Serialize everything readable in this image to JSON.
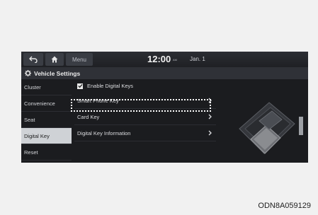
{
  "topbar": {
    "menu_label": "Menu",
    "time": "12:00",
    "ampm": "AM",
    "date": "Jan. 1"
  },
  "title": "Vehicle Settings",
  "sidebar": {
    "items": [
      {
        "label": "Cluster"
      },
      {
        "label": "Convenience"
      },
      {
        "label": "Seat"
      },
      {
        "label": "Digital Key",
        "active": true
      },
      {
        "label": "Reset"
      }
    ]
  },
  "content": {
    "enable_label": "Enable Digital Keys",
    "enable_checked": true,
    "rows": [
      {
        "label": "Smart Phone Key"
      },
      {
        "label": "Card Key"
      },
      {
        "label": "Digital Key Information"
      }
    ]
  },
  "caption": "ODN8A059129",
  "colors": {
    "screen_bg": "#1b1c1f",
    "active_item": "#cfd2d6",
    "highlight": "#ffffff"
  }
}
